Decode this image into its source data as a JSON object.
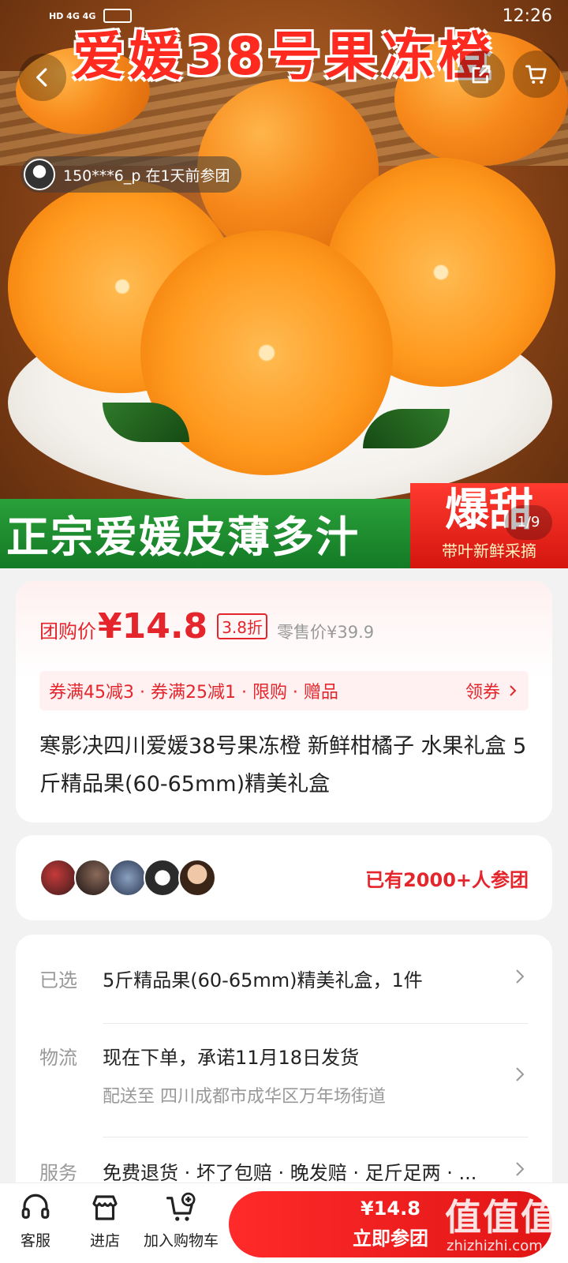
{
  "status_bar": {
    "signal_text": "HD 4G 4G",
    "time": "12:26"
  },
  "hero": {
    "title_text": "爱媛38号果冻橙",
    "bottom_banner_text": "正宗爱媛皮薄多汁",
    "bang_text": "爆甜",
    "bang_sub_text": "带叶新鲜采摘",
    "group_tag": "150***6_p 在1天前参团",
    "page_indicator": "1/9"
  },
  "price_card": {
    "price_label": "团购价",
    "price_value": "¥14.8",
    "discount": "3.8折",
    "original_price": "零售价¥39.9",
    "coupon_text": "券满45减3 · 券满25减1 · 限购 · 赠品",
    "coupon_action": "领券",
    "product_title": "寒影决四川爱媛38号果冻橙 新鲜柑橘子 水果礼盒 5斤精品果(60-65mm)精美礼盒"
  },
  "join_card": {
    "count_text": "已有2000+人参团"
  },
  "info": {
    "selected_label": "已选",
    "selected_value": "5斤精品果(60-65mm)精美礼盒，1件",
    "logistics_label": "物流",
    "logistics_value": "现在下单，承诺11月18日发货",
    "logistics_sub": "配送至  四川成都市成华区万年场街道",
    "service_label": "服务",
    "service_value": "免费退货 · 坏了包赔 · 晚发赔 · 足斤足两 · ..."
  },
  "bottom_bar": {
    "service_label": "客服",
    "store_label": "进店",
    "cart_label": "加入购物车",
    "buy_price": "¥14.8",
    "buy_label": "立即参团"
  },
  "watermark": {
    "text": "值值值",
    "url": "zhizhizhi.com"
  },
  "colors": {
    "accent": "#e4252b",
    "coupon_bg": "#fff1f1",
    "buy_button": "#ff2a2a"
  },
  "icons": [
    "back-icon",
    "share-icon",
    "cart-icon",
    "chevron-right-icon",
    "headset-icon",
    "store-icon",
    "add-cart-icon"
  ]
}
